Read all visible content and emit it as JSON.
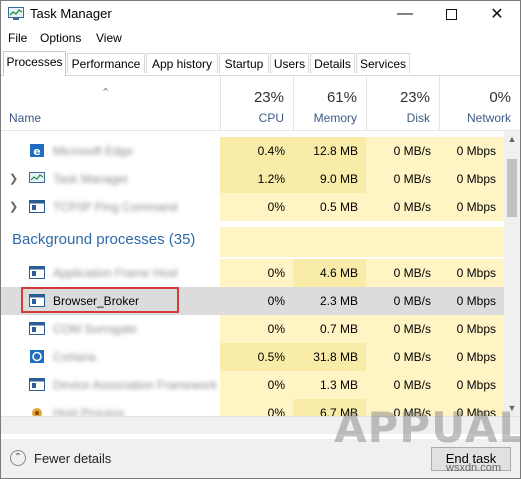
{
  "window": {
    "title": "Task Manager"
  },
  "menu": [
    "File",
    "Options",
    "View"
  ],
  "tabs": [
    "Processes",
    "Performance",
    "App history",
    "Startup",
    "Users",
    "Details",
    "Services"
  ],
  "columns": {
    "name": "Name",
    "cpu": {
      "pct": "23%",
      "label": "CPU"
    },
    "memory": {
      "pct": "61%",
      "label": "Memory"
    },
    "disk": {
      "pct": "23%",
      "label": "Disk"
    },
    "network": {
      "pct": "0%",
      "label": "Network"
    }
  },
  "apps": [
    {
      "name": "Microsoft Edge",
      "cpu": "0.4%",
      "memory": "12.8 MB",
      "disk": "0 MB/s",
      "network": "0 Mbps"
    },
    {
      "name": "Task Manager",
      "cpu": "1.2%",
      "memory": "9.0 MB",
      "disk": "0 MB/s",
      "network": "0 Mbps"
    },
    {
      "name": "TCP/IP Ping Command",
      "cpu": "0%",
      "memory": "0.5 MB",
      "disk": "0 MB/s",
      "network": "0 Mbps"
    }
  ],
  "background_group": "Background processes (35)",
  "background": [
    {
      "name": "Application Frame Host",
      "cpu": "0%",
      "memory": "4.6 MB",
      "disk": "0 MB/s",
      "network": "0 Mbps"
    },
    {
      "name": "Browser_Broker",
      "cpu": "0%",
      "memory": "2.3 MB",
      "disk": "0 MB/s",
      "network": "0 Mbps"
    },
    {
      "name": "COM Surrogate",
      "cpu": "0%",
      "memory": "0.7 MB",
      "disk": "0 MB/s",
      "network": "0 Mbps"
    },
    {
      "name": "Cortana",
      "cpu": "0.5%",
      "memory": "31.8 MB",
      "disk": "0 MB/s",
      "network": "0 Mbps"
    },
    {
      "name": "Device Association Framework",
      "cpu": "0%",
      "memory": "1.3 MB",
      "disk": "0 MB/s",
      "network": "0 Mbps"
    },
    {
      "name": "Host Process",
      "cpu": "0%",
      "memory": "6.7 MB",
      "disk": "0 MB/s",
      "network": "0 Mbps"
    }
  ],
  "footer": {
    "fewer_details": "Fewer details",
    "end_task": "End task"
  },
  "watermark": "APPUALS",
  "watermark_site": "wsxdn.com"
}
